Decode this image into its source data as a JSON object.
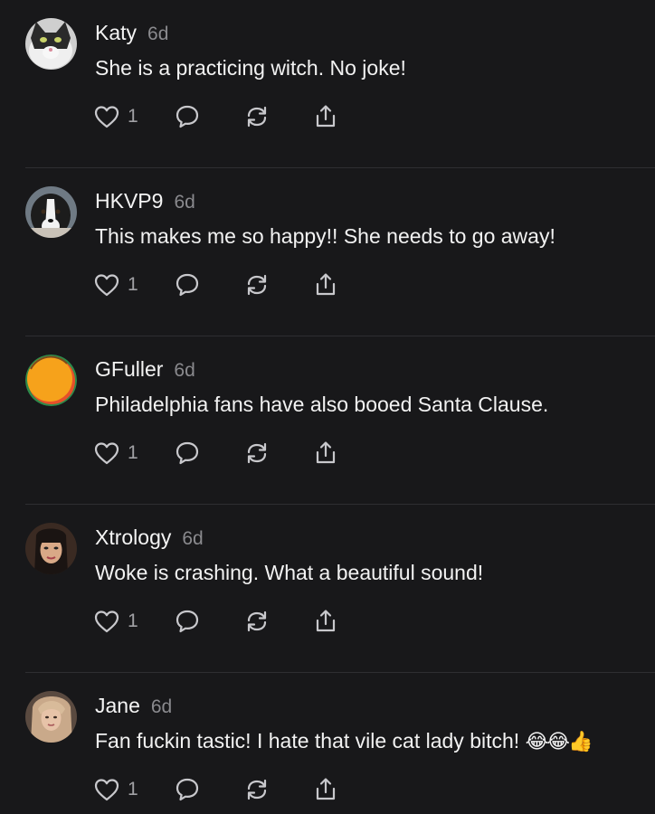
{
  "comments": [
    {
      "username": "Katy",
      "time": "6d",
      "text": "She is a practicing witch. No joke!",
      "likes": "1"
    },
    {
      "username": "HKVP9",
      "time": "6d",
      "text": "This makes me so happy!! She needs to go away!",
      "likes": "1"
    },
    {
      "username": "GFuller",
      "time": "6d",
      "text": "Philadelphia fans have also booed Santa Clause.",
      "likes": "1"
    },
    {
      "username": "Xtrology",
      "time": "6d",
      "text": "Woke is crashing. What a beautiful sound!",
      "likes": "1"
    },
    {
      "username": "Jane",
      "time": "6d",
      "text": "Fan fuckin tastic! I hate that vile cat lady bitch!",
      "emoji": "😂😂👍",
      "likes": "1"
    }
  ],
  "icons": {
    "like": "heart-icon",
    "reply": "speech-bubble-icon",
    "restack": "restack-arrows-icon",
    "share": "share-upload-icon"
  },
  "colors": {
    "background": "#18181a",
    "text": "#f2f2f2",
    "muted": "#8a8a8e",
    "icon": "#c8c8cc",
    "divider": "#2e2e31"
  }
}
